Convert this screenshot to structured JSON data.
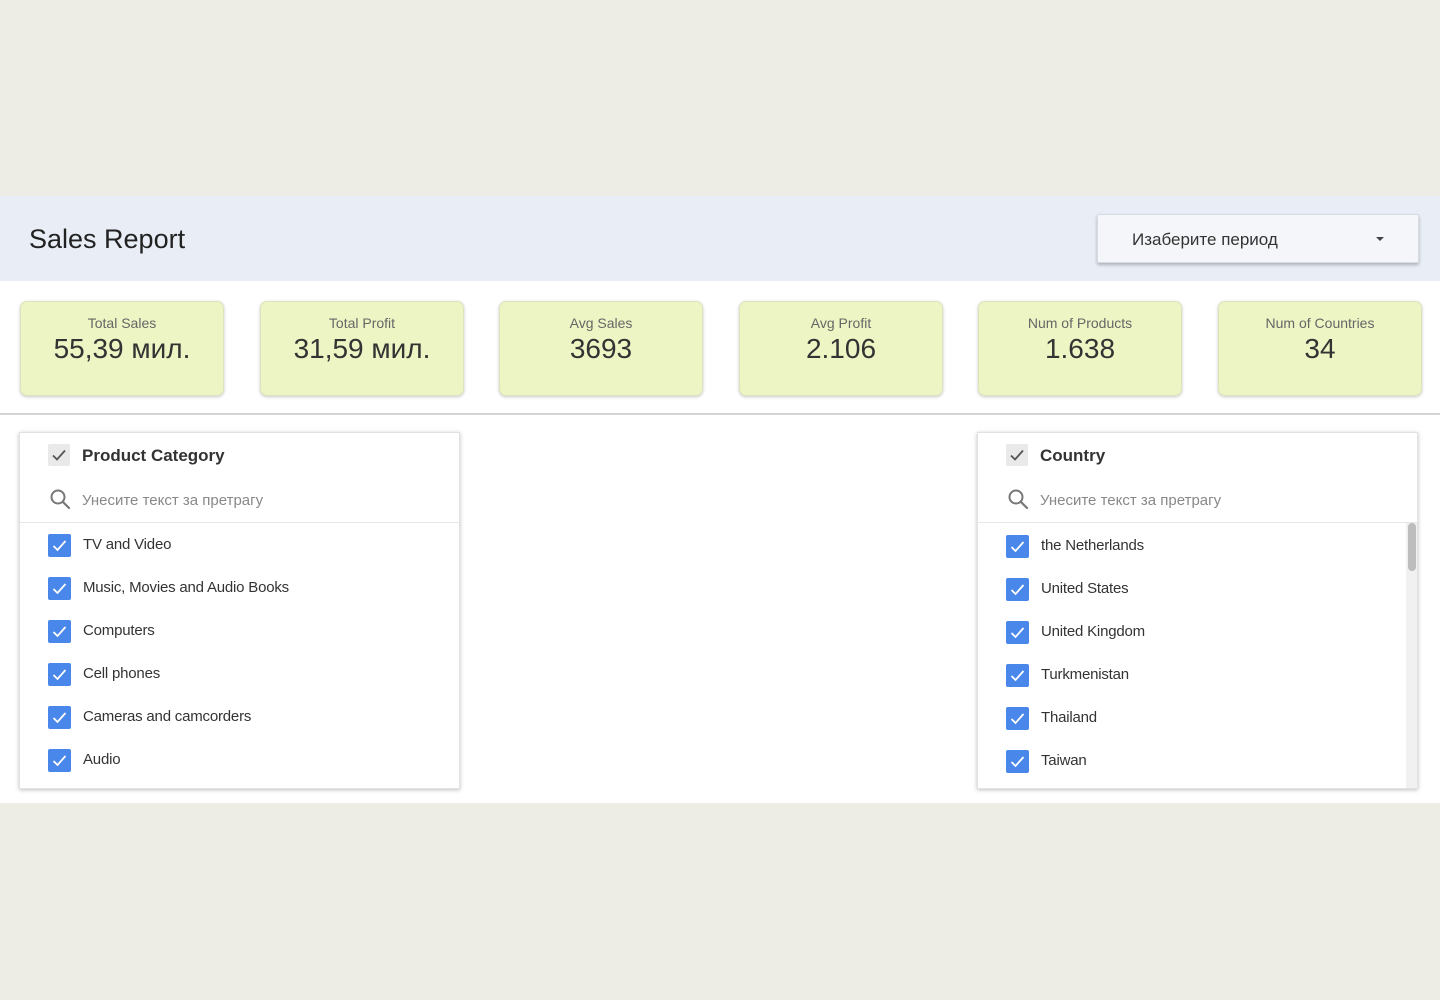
{
  "header": {
    "title": "Sales Report",
    "period_select": {
      "label": "Изаберите период",
      "icon": "caret-down-icon"
    }
  },
  "kpis": [
    {
      "label": "Total Sales",
      "value": "55,39 мил."
    },
    {
      "label": "Total Profit",
      "value": "31,59 мил."
    },
    {
      "label": "Avg Sales",
      "value": "3693"
    },
    {
      "label": "Avg Profit",
      "value": "2.106"
    },
    {
      "label": "Num of Products",
      "value": "1.638"
    },
    {
      "label": "Num of Countries",
      "value": "34"
    }
  ],
  "filters": {
    "category": {
      "title": "Product Category",
      "search_placeholder": "Унесите текст за претрагу",
      "items": [
        {
          "label": "TV and Video",
          "checked": true
        },
        {
          "label": "Music, Movies and Audio Books",
          "checked": true
        },
        {
          "label": "Computers",
          "checked": true
        },
        {
          "label": "Cell phones",
          "checked": true
        },
        {
          "label": "Cameras and camcorders",
          "checked": true
        },
        {
          "label": "Audio",
          "checked": true
        }
      ]
    },
    "country": {
      "title": "Country",
      "search_placeholder": "Унесите текст за претрагу",
      "items": [
        {
          "label": "the Netherlands",
          "checked": true
        },
        {
          "label": "United States",
          "checked": true
        },
        {
          "label": "United Kingdom",
          "checked": true
        },
        {
          "label": "Turkmenistan",
          "checked": true
        },
        {
          "label": "Thailand",
          "checked": true
        },
        {
          "label": "Taiwan",
          "checked": true
        }
      ]
    }
  },
  "colors": {
    "page_background": "#ededE5",
    "header_background": "#e8edf6",
    "kpi_card_background": "#eef5c4",
    "checkbox_checked": "#4a87ea"
  }
}
